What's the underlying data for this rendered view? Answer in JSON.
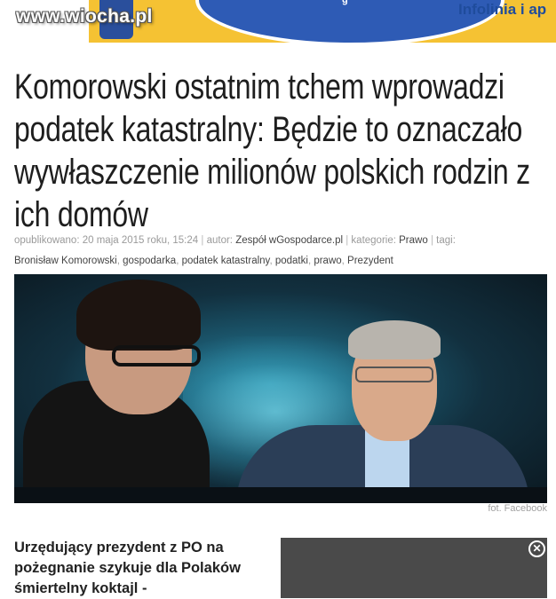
{
  "site": {
    "watermark": "www.wiocha.pl"
  },
  "banner": {
    "oval_text": "g",
    "infolinia": "Infolinia i ap",
    "colors": {
      "background": "#f5c233",
      "oval": "#2e5bb5",
      "text": "#1f4c9c"
    }
  },
  "article": {
    "headline": "Komorowski ostatnim tchem wprowadzi podatek katastralny: Będzie to oznaczało wywłaszczenie milionów polskich rodzin z ich domów",
    "meta": {
      "published_label": "opublikowano:",
      "published_value": "20 maja 2015 roku, 15:24",
      "author_label": "autor:",
      "author_value": "Zespół wGospodarce.pl",
      "category_label": "kategorie:",
      "category_value": "Prawo",
      "tags_label": "tagi:",
      "tags": [
        "Bronisław Komorowski",
        "gospodarka",
        "podatek katastralny",
        "podatki",
        "prawo",
        "Prezydent"
      ]
    },
    "photo_credit": "fot. Facebook",
    "lead": "Urzędujący prezydent z PO na pożegnanie szykuje dla Polaków śmiertelny koktajl -"
  },
  "ad": {
    "close_glyph": "✕"
  }
}
